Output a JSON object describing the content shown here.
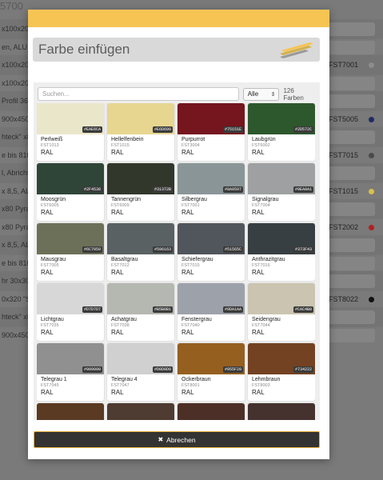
{
  "background_page": {
    "title": "5700",
    "header_text": "mungen",
    "rows": [
      {
        "text": "x100x20, ...",
        "code": "",
        "dot": ""
      },
      {
        "text": "en, ALU",
        "code": "",
        "dot": ""
      },
      {
        "text": "x100x20, A",
        "code": "FST7001",
        "dot": "#8c8c8c"
      },
      {
        "text": "x100x20, A",
        "code": "",
        "dot": ""
      },
      {
        "text": "Profil 36,7",
        "code": "",
        "dot": ""
      },
      {
        "text": "900x450n",
        "code": "FST5005",
        "dot": "#1f2a66"
      },
      {
        "text": "hteck\" x80",
        "code": "",
        "dot": ""
      },
      {
        "text": "e bis 810m",
        "code": "FST7015",
        "dot": "#4a4a4a"
      },
      {
        "text": "l, Abrichte",
        "code": "",
        "dot": ""
      },
      {
        "text": "x 8,5, ALU",
        "code": "FST1015",
        "dot": "#d8c14a"
      },
      {
        "text": "x80 Pyram",
        "code": "",
        "dot": ""
      },
      {
        "text": "x80 Pyram",
        "code": "FST2002",
        "dot": "#b22020"
      },
      {
        "text": "x 8,5, ALU",
        "code": "",
        "dot": ""
      },
      {
        "text": "e bis 810m",
        "code": "",
        "dot": ""
      },
      {
        "text": "hr 30x30x",
        "code": "",
        "dot": ""
      },
      {
        "text": "0x320 \"Ste",
        "code": "FST8022",
        "dot": "#111111"
      },
      {
        "text": "hteck\" x80",
        "code": "",
        "dot": ""
      },
      {
        "text": "900x450n",
        "code": "",
        "dot": ""
      }
    ]
  },
  "modal": {
    "title": "Farbe einfügen",
    "search_placeholder": "Suchen...",
    "filter_value": "Alle",
    "count_text": "126 Farben",
    "cancel_label": "Abrechen",
    "colors": [
      {
        "name": "Perlweiß",
        "code": "FST1013",
        "system": "RAL",
        "hex": "#EAE6CA"
      },
      {
        "name": "Hellelfenbein",
        "code": "FST1015",
        "system": "RAL",
        "hex": "#E6D690"
      },
      {
        "name": "Purpurrot",
        "code": "FST3004",
        "system": "RAL",
        "hex": "#75151E"
      },
      {
        "name": "Laubgrün",
        "code": "FST6002",
        "system": "RAL",
        "hex": "#2D572C"
      },
      {
        "name": "Moosgrün",
        "code": "FST6005",
        "system": "RAL",
        "hex": "#2F4538"
      },
      {
        "name": "Tannengrün",
        "code": "FST6009",
        "system": "RAL",
        "hex": "#31372B"
      },
      {
        "name": "Silbergrau",
        "code": "FST7001",
        "system": "RAL",
        "hex": "#8A9597"
      },
      {
        "name": "Signalgrau",
        "code": "FST7004",
        "system": "RAL",
        "hex": "#9EA0A1"
      },
      {
        "name": "Mausgrau",
        "code": "FST7005",
        "system": "RAL",
        "hex": "#6C7059"
      },
      {
        "name": "Basaltgrau",
        "code": "FST7012",
        "system": "RAL",
        "hex": "#596163"
      },
      {
        "name": "Schiefergrau",
        "code": "FST7015",
        "system": "RAL",
        "hex": "#51565C"
      },
      {
        "name": "Anthrazitgrau",
        "code": "FST7016",
        "system": "RAL",
        "hex": "#373F43"
      },
      {
        "name": "Lichtgrau",
        "code": "FST7035",
        "system": "RAL",
        "hex": "#D7D7D7"
      },
      {
        "name": "Achatgrau",
        "code": "FST7038",
        "system": "RAL",
        "hex": "#B5B8B1"
      },
      {
        "name": "Fenstergrau",
        "code": "FST7040",
        "system": "RAL",
        "hex": "#9DA1AA"
      },
      {
        "name": "Seidengrau",
        "code": "FST7044",
        "system": "RAL",
        "hex": "#CAC4B0"
      },
      {
        "name": "Telegrau 1",
        "code": "FST7045",
        "system": "RAL",
        "hex": "#909090"
      },
      {
        "name": "Telegrau 4",
        "code": "FST7047",
        "system": "RAL",
        "hex": "#D0D0D0"
      },
      {
        "name": "Ockerbraun",
        "code": "FST8001",
        "system": "RAL",
        "hex": "#955F20"
      },
      {
        "name": "Lehmbraun",
        "code": "FST8003",
        "system": "RAL",
        "hex": "#734222"
      },
      {
        "name": "",
        "code": "",
        "system": "",
        "hex": "#5A3A22"
      },
      {
        "name": "",
        "code": "",
        "system": "",
        "hex": "#4E3B31"
      },
      {
        "name": "",
        "code": "",
        "system": "",
        "hex": "#4C2F27"
      },
      {
        "name": "",
        "code": "",
        "system": "",
        "hex": "#45322E"
      }
    ]
  }
}
